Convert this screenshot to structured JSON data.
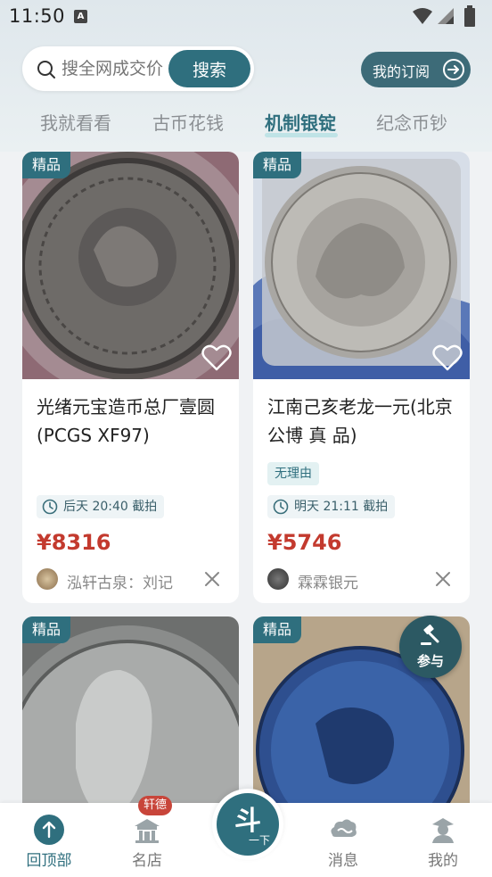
{
  "status_bar": {
    "time": "11:50",
    "notif": "A"
  },
  "search": {
    "placeholder": "搜全网成交价",
    "button": "搜索"
  },
  "subscribe": {
    "label": "我的订阅"
  },
  "tabs": [
    {
      "label": "我就看看"
    },
    {
      "label": "古币花钱"
    },
    {
      "label": "机制银锭",
      "active": true
    },
    {
      "label": "纪念币钞"
    }
  ],
  "cards": [
    {
      "badge": "精品",
      "title": "光绪元宝造币总厂壹圆(PCGS XF97)",
      "tag": "",
      "time": "后天 20:40 截拍",
      "price": "¥8316",
      "seller": "泓轩古泉：刘记"
    },
    {
      "badge": "精品",
      "title": "江南己亥老龙一元(北京公博 真 品)",
      "tag": "无理由",
      "time": "明天 21:11 截拍",
      "price": "¥5746",
      "seller": "霖霖银元"
    },
    {
      "badge": "精品"
    },
    {
      "badge": "精品"
    }
  ],
  "float_join": {
    "label": "参与"
  },
  "bottom_nav": {
    "items": [
      {
        "label": "回顶部",
        "active": true
      },
      {
        "label": "名店",
        "badge": "轩德"
      },
      {
        "label": "斗一下",
        "big": "斗",
        "small": "一下"
      },
      {
        "label": "消息"
      },
      {
        "label": "我的"
      }
    ]
  },
  "colors": {
    "accent": "#2f6f7e",
    "price": "#c33a2e"
  }
}
